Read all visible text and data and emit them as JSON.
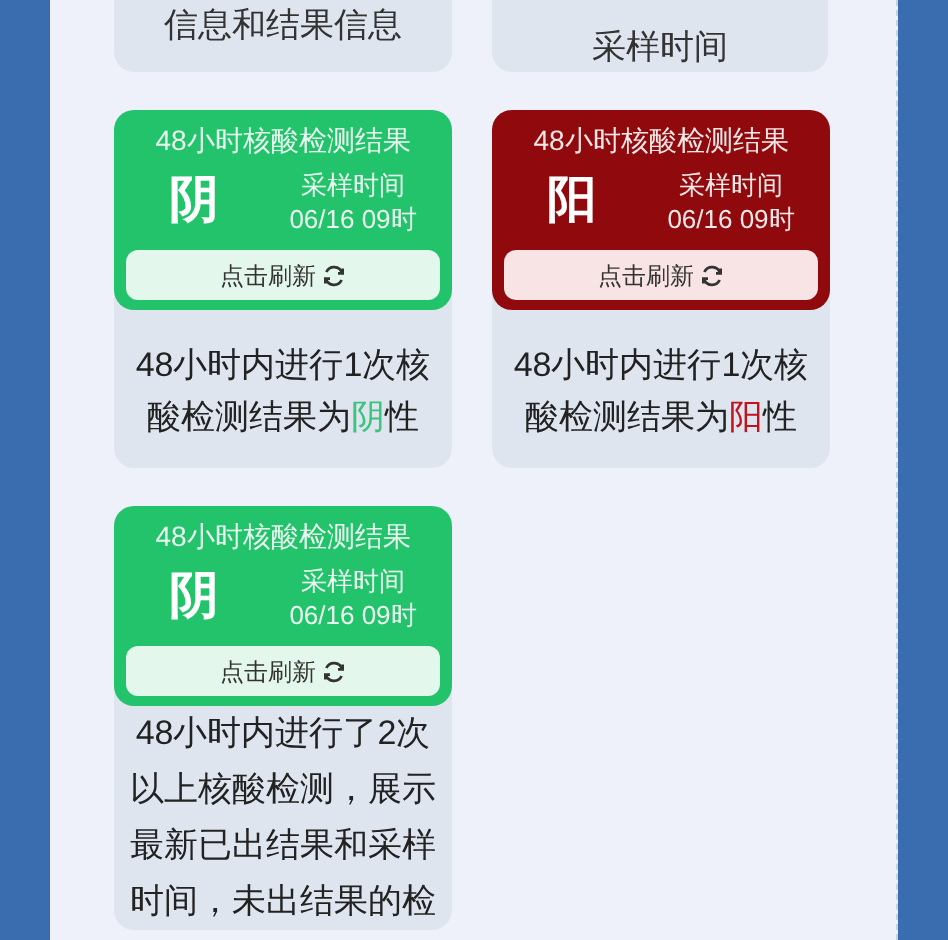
{
  "top_cards": [
    {
      "lines": [
        "信息和结果信息"
      ]
    },
    {
      "lines": [
        "采样时间"
      ]
    }
  ],
  "cards": [
    {
      "kind": "negative",
      "title": "48小时核酸检测结果",
      "result_char": "阴",
      "sample_label": "采样时间",
      "sample_time": "06/16 09时",
      "refresh_label": "点击刷新",
      "description": [
        [
          {
            "text": "48小时内进行1次核",
            "emphasis": false
          }
        ],
        [
          {
            "text": "酸检测结果为",
            "emphasis": false
          },
          {
            "text": "阴",
            "emphasis": true
          },
          {
            "text": "性",
            "emphasis": false
          }
        ]
      ]
    },
    {
      "kind": "positive",
      "title": "48小时核酸检测结果",
      "result_char": "阳",
      "sample_label": "采样时间",
      "sample_time": "06/16 09时",
      "refresh_label": "点击刷新",
      "description": [
        [
          {
            "text": "48小时内进行1次核",
            "emphasis": false
          }
        ],
        [
          {
            "text": "酸检测结果为",
            "emphasis": false
          },
          {
            "text": "阳",
            "emphasis": true
          },
          {
            "text": "性",
            "emphasis": false
          }
        ]
      ]
    },
    {
      "kind": "negative",
      "title": "48小时核酸检测结果",
      "result_char": "阴",
      "sample_label": "采样时间",
      "sample_time": "06/16 09时",
      "refresh_label": "点击刷新",
      "description": [
        [
          {
            "text": "48小时内进行了2次",
            "emphasis": false
          }
        ],
        [
          {
            "text": "以上核酸检测，展示",
            "emphasis": false
          }
        ],
        [
          {
            "text": "最新已出结果和采样",
            "emphasis": false
          }
        ],
        [
          {
            "text": "时间，未出结果的检",
            "emphasis": false
          }
        ]
      ]
    }
  ]
}
